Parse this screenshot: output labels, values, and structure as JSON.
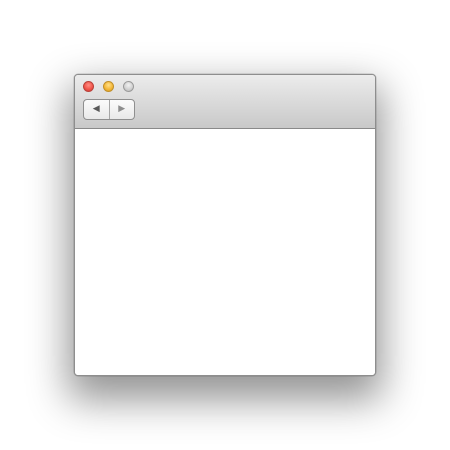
{
  "window": {
    "title": "",
    "traffic_lights": {
      "close": {
        "icon": "close-icon",
        "color": "#f2574c"
      },
      "minimize": {
        "icon": "minimize-icon",
        "color": "#f4b83a"
      },
      "zoom": {
        "icon": "zoom-icon",
        "color": "#cfcfcf"
      }
    },
    "toolbar": {
      "back": {
        "glyph": "◀",
        "icon": "back-arrow-icon"
      },
      "forward": {
        "glyph": "▶",
        "icon": "forward-arrow-icon"
      }
    }
  }
}
